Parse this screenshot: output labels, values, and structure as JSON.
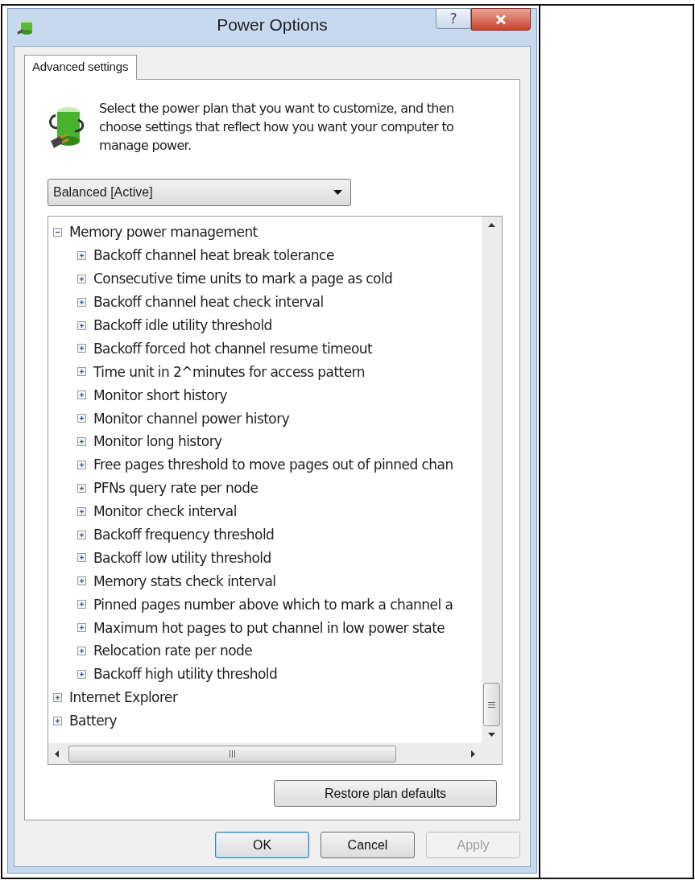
{
  "window": {
    "title": "Power Options",
    "help": "?"
  },
  "tabs": [
    {
      "label": "Advanced settings",
      "selected": true
    }
  ],
  "description": "Select the power plan that you want to customize, and then choose settings that reflect how you want your computer to manage power.",
  "plan_dropdown": {
    "value": "Balanced [Active]"
  },
  "tree": [
    {
      "label": "Memory power management",
      "expanded": true,
      "children": [
        {
          "label": "Backoff channel heat break tolerance",
          "expanded": false
        },
        {
          "label": "Consecutive time units to mark a page as cold",
          "expanded": false
        },
        {
          "label": "Backoff channel heat check interval",
          "expanded": false
        },
        {
          "label": "Backoff idle utility threshold",
          "expanded": false
        },
        {
          "label": "Backoff forced hot channel resume timeout",
          "expanded": false
        },
        {
          "label": "Time unit in 2^minutes for access pattern",
          "expanded": false
        },
        {
          "label": "Monitor short history",
          "expanded": false
        },
        {
          "label": "Monitor channel power history",
          "expanded": false
        },
        {
          "label": "Monitor long history",
          "expanded": false
        },
        {
          "label": "Free pages threshold to move pages out of pinned chan",
          "expanded": false
        },
        {
          "label": "PFNs query rate per node",
          "expanded": false
        },
        {
          "label": "Monitor check interval",
          "expanded": false
        },
        {
          "label": "Backoff frequency threshold",
          "expanded": false
        },
        {
          "label": "Backoff low utility threshold",
          "expanded": false
        },
        {
          "label": "Memory stats check interval",
          "expanded": false
        },
        {
          "label": "Pinned pages number above which to mark a channel a",
          "expanded": false
        },
        {
          "label": "Maximum hot pages to put channel in low power state",
          "expanded": false
        },
        {
          "label": "Relocation rate per node",
          "expanded": false
        },
        {
          "label": "Backoff high utility threshold",
          "expanded": false
        }
      ]
    },
    {
      "label": "Internet Explorer",
      "expanded": false
    },
    {
      "label": "Battery",
      "expanded": false
    }
  ],
  "restore_button": "Restore plan defaults",
  "buttons": [
    {
      "label": "OK",
      "default": true,
      "disabled": false
    },
    {
      "label": "Cancel",
      "default": false,
      "disabled": false
    },
    {
      "label": "Apply",
      "default": false,
      "disabled": true
    }
  ]
}
